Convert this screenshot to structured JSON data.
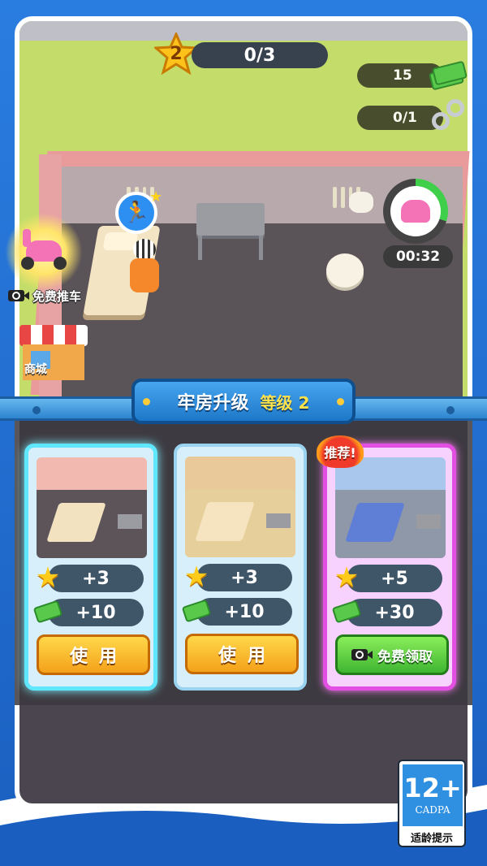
{
  "hud": {
    "level": "2",
    "level_progress": "0/3",
    "cash": "15",
    "handcuffs": "0/1",
    "timer": "00:32"
  },
  "world": {
    "free_cart_label": "免费推车",
    "shop_label": "商城"
  },
  "upgrade_panel": {
    "title": "牢房升级",
    "level_label": "等级 2",
    "recommend_tag": "推荐!",
    "cards": [
      {
        "star_bonus": "+3",
        "cash_bonus": "+10",
        "button": "使用"
      },
      {
        "star_bonus": "+3",
        "cash_bonus": "+10",
        "button": "使用"
      },
      {
        "star_bonus": "+5",
        "cash_bonus": "+30",
        "button": "免费领取"
      }
    ]
  },
  "age_rating": {
    "age": "12+",
    "org": "CADPA",
    "caption": "适龄提示"
  },
  "colors": {
    "frame_blue": "#1e6fd0",
    "grass": "#c4dd6a",
    "cell_wall": "#e99a9a",
    "panel_blue": "#1e78c9",
    "selected_glow": "#5ee7ff",
    "recommended_border": "#e34fe3",
    "use_button": "#f4a11a",
    "free_button": "#3fb532"
  },
  "icons": {
    "level": "star-icon",
    "cash": "cash-icon",
    "handcuffs": "handcuffs-icon",
    "video": "video-icon",
    "scooter": "scooter-icon"
  }
}
